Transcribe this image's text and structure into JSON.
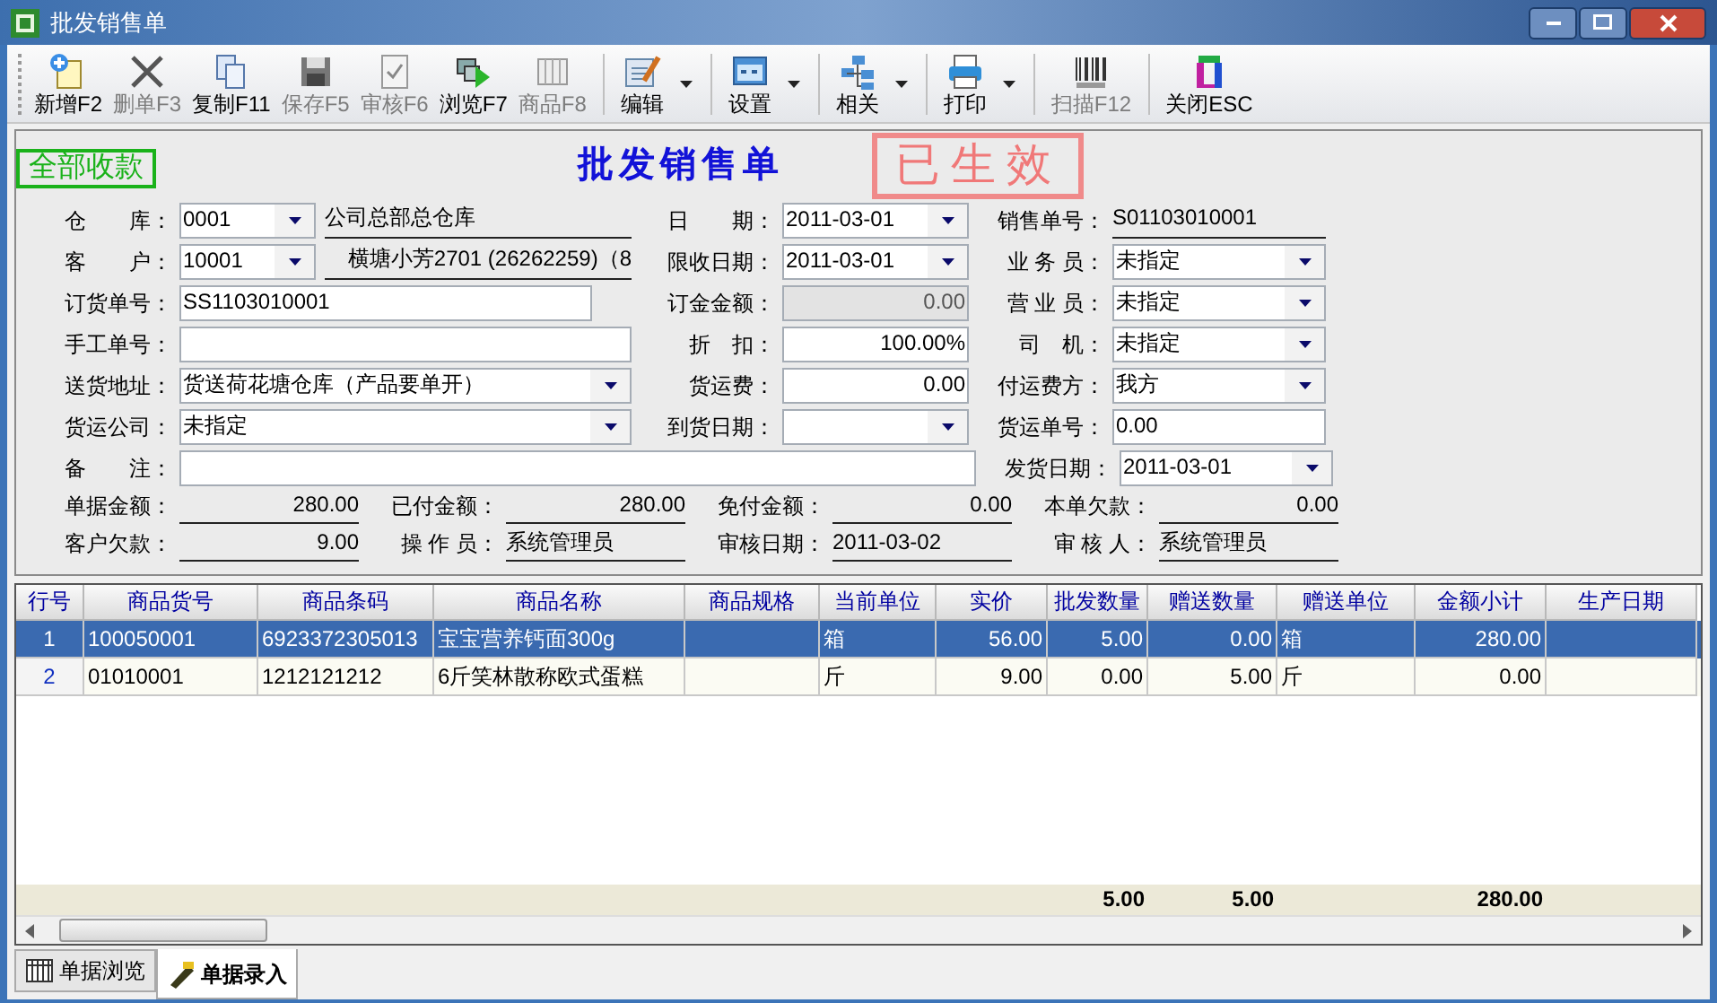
{
  "window": {
    "title": "批发销售单"
  },
  "toolbar": [
    {
      "kind": "button",
      "label": "新增F2",
      "disabled": false,
      "dropdown": false
    },
    {
      "kind": "button",
      "label": "删单F3",
      "disabled": true,
      "dropdown": false
    },
    {
      "kind": "button",
      "label": "复制F11",
      "disabled": false,
      "dropdown": false
    },
    {
      "kind": "button",
      "label": "保存F5",
      "disabled": true,
      "dropdown": false
    },
    {
      "kind": "button",
      "label": "审核F6",
      "disabled": true,
      "dropdown": false
    },
    {
      "kind": "button",
      "label": "浏览F7",
      "disabled": false,
      "dropdown": false
    },
    {
      "kind": "button",
      "label": "商品F8",
      "disabled": true,
      "dropdown": false
    },
    {
      "kind": "separator"
    },
    {
      "kind": "button",
      "label": "编辑",
      "disabled": false,
      "dropdown": true
    },
    {
      "kind": "separator"
    },
    {
      "kind": "button",
      "label": "设置",
      "disabled": false,
      "dropdown": true
    },
    {
      "kind": "separator"
    },
    {
      "kind": "button",
      "label": "相关",
      "disabled": false,
      "dropdown": true
    },
    {
      "kind": "separator"
    },
    {
      "kind": "button",
      "label": "打印",
      "disabled": false,
      "dropdown": true
    },
    {
      "kind": "separator"
    },
    {
      "kind": "button",
      "label": "扫描F12",
      "disabled": true,
      "dropdown": false
    },
    {
      "kind": "separator"
    },
    {
      "kind": "button",
      "label": "关闭ESC",
      "disabled": false,
      "dropdown": false
    }
  ],
  "form": {
    "title": "批发销售单",
    "stamp": "已生效",
    "payment_badge": "全部收款",
    "rows": [
      {
        "left": {
          "label": "仓　　库：",
          "controls": [
            {
              "kind": "combo",
              "value": "0001"
            },
            {
              "kind": "display",
              "value": "公司总部总仓库"
            }
          ]
        },
        "middle": {
          "label": "日　　期：",
          "controls": [
            {
              "kind": "combo",
              "value": "2011-03-01"
            }
          ]
        },
        "right": {
          "label": "销售单号：",
          "controls": [
            {
              "kind": "display",
              "value": "S01103010001"
            }
          ]
        }
      },
      {
        "left": {
          "label": "客　　户：",
          "controls": [
            {
              "kind": "combo",
              "value": "10001"
            },
            {
              "kind": "display",
              "value": "横塘小芳2701 (26262259)（8"
            }
          ]
        },
        "middle": {
          "label": "限收日期：",
          "controls": [
            {
              "kind": "combo",
              "value": "2011-03-01"
            }
          ]
        },
        "right": {
          "label": "业 务 员：",
          "controls": [
            {
              "kind": "combo",
              "value": "未指定"
            }
          ]
        }
      },
      {
        "left": {
          "label": "订货单号：",
          "controls": [
            {
              "kind": "input",
              "value": "SS1103010001"
            }
          ]
        },
        "middle": {
          "label": "订金金额：",
          "controls": [
            {
              "kind": "disabled",
              "value": "0.00"
            }
          ]
        },
        "right": {
          "label": "营 业 员：",
          "controls": [
            {
              "kind": "combo",
              "value": "未指定"
            }
          ]
        }
      },
      {
        "left": {
          "label": "手工单号：",
          "controls": [
            {
              "kind": "input"
            }
          ]
        },
        "middle": {
          "label": "折　扣：",
          "controls": [
            {
              "kind": "input",
              "value": "100.00%"
            }
          ]
        },
        "right": {
          "label": "司　机：",
          "controls": [
            {
              "kind": "combo",
              "value": "未指定"
            }
          ]
        }
      },
      {
        "left": {
          "label": "送货地址：",
          "controls": [
            {
              "kind": "combo",
              "value": "货送荷花塘仓库（产品要单开）"
            }
          ]
        },
        "middle": {
          "label": "货运费：",
          "controls": [
            {
              "kind": "input",
              "value": "0.00"
            }
          ]
        },
        "right": {
          "label": "付运费方：",
          "controls": [
            {
              "kind": "combo",
              "value": "我方"
            }
          ]
        }
      },
      {
        "left": {
          "label": "货运公司：",
          "controls": [
            {
              "kind": "combo",
              "value": "未指定"
            }
          ]
        },
        "middle": {
          "label": "到货日期：",
          "controls": [
            {
              "kind": "combo"
            }
          ]
        },
        "right": {
          "label": "货运单号：",
          "controls": [
            {
              "kind": "input",
              "value": "0.00"
            }
          ]
        }
      },
      {
        "left": {
          "label": "备　　注：",
          "controls": [
            {
              "kind": "input"
            }
          ]
        },
        "right": {
          "label": "发货日期：",
          "controls": [
            {
              "kind": "combo",
              "value": "2011-03-01"
            }
          ]
        }
      }
    ],
    "summary": [
      [
        {
          "label": "单据金额：",
          "value": "280.00"
        },
        {
          "label": "已付金额：",
          "value": "280.00"
        },
        {
          "label": "免付金额：",
          "value": "0.00"
        },
        {
          "label": "本单欠款：",
          "value": "0.00"
        }
      ],
      [
        {
          "label": "客户欠款：",
          "value": "9.00"
        },
        {
          "label": "操 作 员：",
          "value": "系统管理员"
        },
        {
          "label": "审核日期：",
          "value": "2011-03-02"
        },
        {
          "label": "审 核 人：",
          "value": "系统管理员"
        }
      ]
    ]
  },
  "table": {
    "columns": [
      "行号",
      "商品货号",
      "商品条码",
      "商品名称",
      "商品规格",
      "当前单位",
      "实价",
      "批发数量",
      "赠送数量",
      "赠送单位",
      "金额小计",
      "生产日期"
    ],
    "rows": [
      {
        "no": "1",
        "code": "100050001",
        "barcode": "6923372305013",
        "name": "宝宝营养钙面300g",
        "unit": "箱",
        "price": "56.00",
        "qty": "5.00",
        "gift_qty": "0.00",
        "gift_unit": "箱",
        "subtotal": "280.00",
        "selected": true
      },
      {
        "no": "2",
        "code": "01010001",
        "barcode": "1212121212",
        "name": "6斤笑林散称欧式蛋糕",
        "unit": "斤",
        "price": "9.00",
        "qty": "0.00",
        "gift_qty": "5.00",
        "gift_unit": "斤",
        "subtotal": "0.00",
        "selected": false
      }
    ],
    "totals": {
      "qty": "5.00",
      "gift_qty": "5.00",
      "subtotal": "280.00"
    }
  },
  "tabs": [
    {
      "label": "单据浏览",
      "selected": false
    },
    {
      "label": "单据录入",
      "selected": true
    }
  ]
}
